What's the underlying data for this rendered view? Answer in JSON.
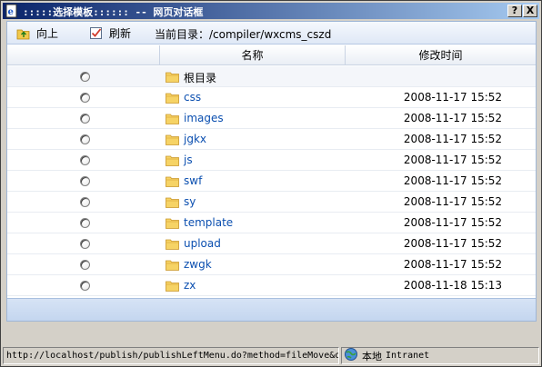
{
  "window": {
    "title": ":::::选择模板:::::: -- 网页对话框",
    "help_button": "?",
    "close_button": "X"
  },
  "toolbar": {
    "up_label": "向上",
    "refresh_label": "刷新",
    "path_label": "当前目录：/compiler/wxcms_cszd"
  },
  "table": {
    "columns": [
      "",
      "名称",
      "修改时间"
    ],
    "rows": [
      {
        "name": "根目录",
        "time": "",
        "link": false
      },
      {
        "name": "css",
        "time": "2008-11-17 15:52",
        "link": true
      },
      {
        "name": "images",
        "time": "2008-11-17 15:52",
        "link": true
      },
      {
        "name": "jgkx",
        "time": "2008-11-17 15:52",
        "link": true
      },
      {
        "name": "js",
        "time": "2008-11-17 15:52",
        "link": true
      },
      {
        "name": "swf",
        "time": "2008-11-17 15:52",
        "link": true
      },
      {
        "name": "sy",
        "time": "2008-11-17 15:52",
        "link": true
      },
      {
        "name": "template",
        "time": "2008-11-17 15:52",
        "link": true
      },
      {
        "name": "upload",
        "time": "2008-11-17 15:52",
        "link": true
      },
      {
        "name": "zwgk",
        "time": "2008-11-17 15:52",
        "link": true
      },
      {
        "name": "zx",
        "time": "2008-11-18 15:13",
        "link": true
      }
    ]
  },
  "status": {
    "url": "http://localhost/publish/publishLeftMenu.do?method=fileMove&o",
    "zone_cn": "本地",
    "zone_en": "Intranet"
  },
  "colors": {
    "title_start": "#0a246a",
    "link": "#0b4fb0"
  }
}
